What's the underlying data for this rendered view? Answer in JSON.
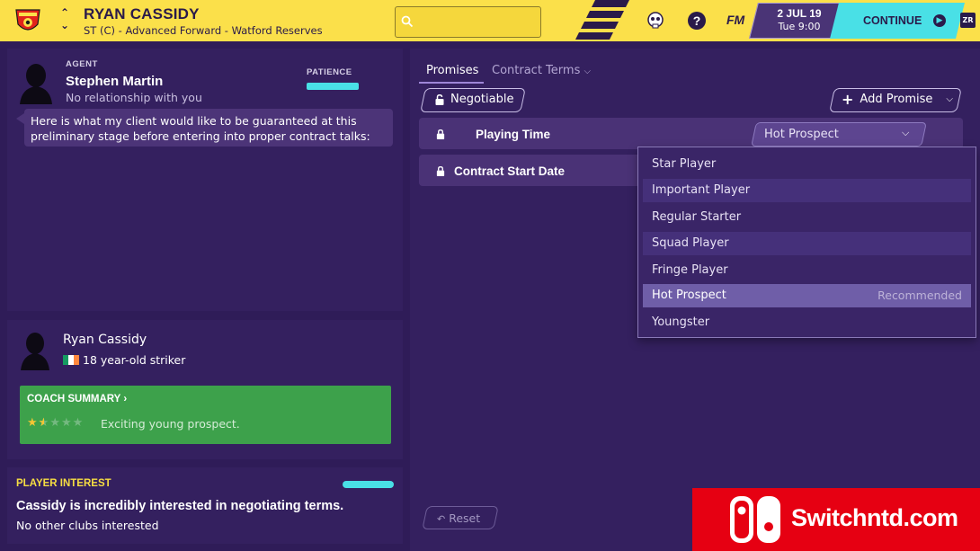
{
  "header": {
    "player_name": "RYAN CASSIDY",
    "player_subtitle": "ST (C) - Advanced Forward - Watford Reserves",
    "search_placeholder": "",
    "fm_logo": "FM",
    "date": "2 JUL 19",
    "time": "Tue 9:00",
    "continue_label": "CONTINUE",
    "zr_tag": "ZR",
    "colors": {
      "bar": "#fbe04a",
      "continue": "#49e0e6"
    }
  },
  "agent": {
    "label": "AGENT",
    "name": "Stephen Martin",
    "relationship": "No relationship with you",
    "patience_label": "PATIENCE",
    "message": "Here is what my client would like to be guaranteed at this preliminary stage before entering into proper contract talks:"
  },
  "player_card": {
    "name": "Ryan Cassidy",
    "info": "18 year-old striker",
    "coach_summary_title": "COACH SUMMARY",
    "coach_summary_text": "Exciting young prospect.",
    "star_rating": 1.5,
    "star_max": 5
  },
  "interest": {
    "label": "PLAYER INTEREST",
    "main": "Cassidy is incredibly interested in negotiating terms.",
    "sub": "No other clubs interested"
  },
  "tabs": [
    {
      "label": "Promises",
      "active": true
    },
    {
      "label": "Contract Terms",
      "active": false
    }
  ],
  "toolbar": {
    "negotiable_label": "Negotiable",
    "add_promise_label": "Add Promise"
  },
  "promises": [
    {
      "label": "Playing Time",
      "value": "Hot Prospect"
    },
    {
      "label": "Contract Start Date"
    }
  ],
  "dropdown": {
    "options": [
      {
        "label": "Star Player"
      },
      {
        "label": "Important Player"
      },
      {
        "label": "Regular Starter"
      },
      {
        "label": "Squad Player"
      },
      {
        "label": "Fringe Player"
      },
      {
        "label": "Hot Prospect",
        "note": "Recommended",
        "selected": true
      },
      {
        "label": "Youngster"
      }
    ]
  },
  "reset_label": "Reset",
  "watermark": {
    "text": "Switchntd.com"
  }
}
